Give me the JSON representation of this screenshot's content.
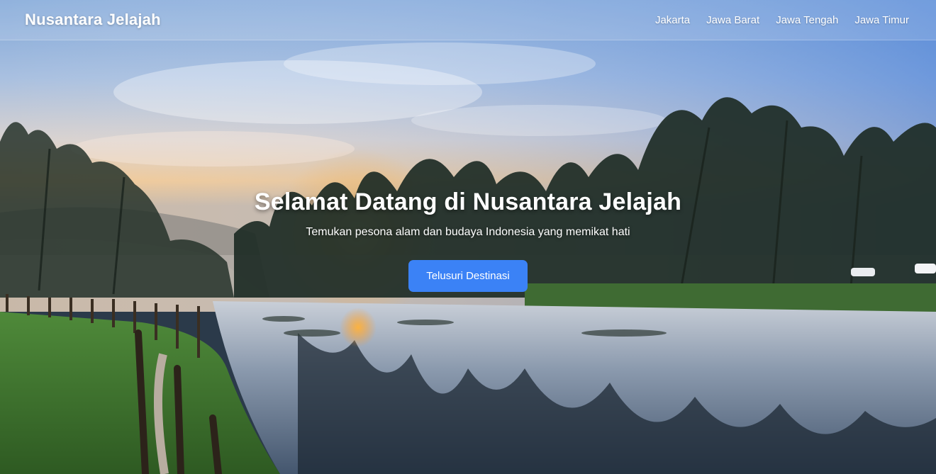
{
  "nav": {
    "brand": "Nusantara Jelajah",
    "links": [
      "Jakarta",
      "Jawa Barat",
      "Jawa Tengah",
      "Jawa Timur"
    ]
  },
  "hero": {
    "title": "Selamat Datang di Nusantara Jelajah",
    "subtitle": "Temukan pesona alam dan budaya Indonesia yang memikat hati",
    "cta_label": "Telusuri Destinasi",
    "background": "lake-sunrise-photo"
  },
  "colors": {
    "accent": "#3b82f6",
    "text": "#ffffff"
  }
}
